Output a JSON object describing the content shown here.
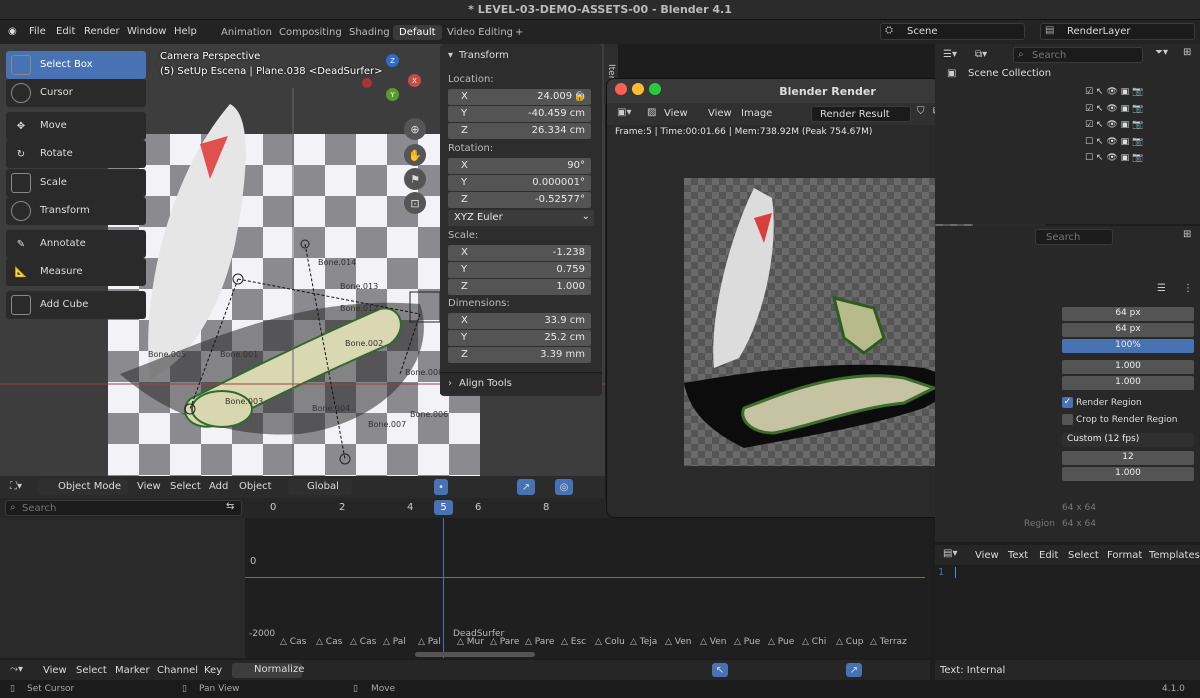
{
  "window": {
    "title": "* LEVEL-03-DEMO-ASSETS-00 - Blender 4.1"
  },
  "menu": [
    "File",
    "Edit",
    "Render",
    "Window",
    "Help"
  ],
  "workspaces": [
    "Animation",
    "Compositing",
    "Shading",
    "Default",
    "Video Editing"
  ],
  "active_workspace": "Default",
  "add_tab": "+",
  "scene": {
    "name": "Scene",
    "layer": "RenderLayer"
  },
  "tools": [
    {
      "label": "Select Box",
      "icon": "select-box-icon"
    },
    {
      "label": "Cursor",
      "icon": "cursor-icon"
    },
    {
      "label": "Move",
      "icon": "move-icon"
    },
    {
      "label": "Rotate",
      "icon": "rotate-icon"
    },
    {
      "label": "Scale",
      "icon": "scale-icon"
    },
    {
      "label": "Transform",
      "icon": "transform-icon"
    },
    {
      "label": "Annotate",
      "icon": "annotate-icon"
    },
    {
      "label": "Measure",
      "icon": "measure-icon"
    },
    {
      "label": "Add Cube",
      "icon": "add-cube-icon"
    }
  ],
  "viewport": {
    "view_name": "Camera Perspective",
    "context": "(5) SetUp Escena | Plane.038 <DeadSurfer>",
    "axis_x": "X",
    "axis_y": "Y",
    "axis_z": "Z",
    "bones": [
      "Bone.014",
      "Bone.013",
      "Bone.012",
      "Bone.005",
      "Bone.001",
      "Bone.002",
      "Bone.004",
      "Bone.003",
      "Bone.006",
      "Bone.007",
      "Bone.008"
    ],
    "mode": "Object Mode",
    "header_menus": [
      "View",
      "Select",
      "Add",
      "Object"
    ],
    "orientation": "Global"
  },
  "transform": {
    "title": "Transform",
    "location_label": "Location:",
    "location": [
      {
        "axis": "X",
        "value": "24.009 m"
      },
      {
        "axis": "Y",
        "value": "-40.459 cm"
      },
      {
        "axis": "Z",
        "value": "26.334 cm"
      }
    ],
    "rotation_label": "Rotation:",
    "rotation": [
      {
        "axis": "X",
        "value": "90°"
      },
      {
        "axis": "Y",
        "value": "0.000001°"
      },
      {
        "axis": "Z",
        "value": "-0.52577°"
      }
    ],
    "rotation_mode": "XYZ Euler",
    "scale_label": "Scale:",
    "scale": [
      {
        "axis": "X",
        "value": "-1.238"
      },
      {
        "axis": "Y",
        "value": "0.759"
      },
      {
        "axis": "Z",
        "value": "1.000"
      }
    ],
    "dimensions_label": "Dimensions:",
    "dimensions": [
      {
        "axis": "X",
        "value": "33.9 cm"
      },
      {
        "axis": "Y",
        "value": "25.2 cm"
      },
      {
        "axis": "Z",
        "value": "3.39 mm"
      }
    ],
    "align_tools": "Align Tools",
    "tab": "Item"
  },
  "render_window": {
    "title": "Blender Render",
    "menus": [
      "View",
      "View",
      "Image"
    ],
    "slot": "Render Result",
    "info": "Frame:5 | Time:00:01.66 | Mem:738.92M (Peak 754.67M)"
  },
  "outliner": {
    "search_placeholder": "Search",
    "scene_collection": "Scene Collection"
  },
  "properties": {
    "search_placeholder": "Search",
    "resolution_x": "64 px",
    "resolution_y": "64 px",
    "resolution_pct": "100%",
    "aspect_x": "1.000",
    "aspect_y": "1.000",
    "render_region": "Render Region",
    "crop_region": "Crop to Render Region",
    "frame_rate": "Custom (12 fps)",
    "fps": "12",
    "base": "1.000",
    "res_info_label": "",
    "res_info": "64 x 64",
    "region_label": "Region",
    "region_info": "64 x 64"
  },
  "text_editor": {
    "menus": [
      "View",
      "Text",
      "Edit",
      "Select",
      "Format",
      "Templates"
    ],
    "line": "1",
    "status": "Text: Internal"
  },
  "dopesheet": {
    "search_placeholder": "Search",
    "frames": [
      "0",
      "2",
      "4",
      "6",
      "8"
    ],
    "current_frame": "5",
    "value_zero": "0",
    "value_min": "-2000",
    "object": "DeadSurfer",
    "keys": [
      "Cas",
      "Cas",
      "Cas",
      "Pal",
      "Pal",
      "Mur",
      "Pare",
      "Pare",
      "Esc",
      "Colu",
      "Teja",
      "Ven",
      "Ven",
      "Pue",
      "Pue",
      "Chi",
      "Cup",
      "Terraz"
    ],
    "menus": [
      "View",
      "Select",
      "Marker",
      "Channel",
      "Key"
    ],
    "normalize": "Normalize"
  },
  "statusbar": {
    "left": "Set Cursor",
    "mid": "Pan View",
    "right": "Move",
    "version": "4.1.0"
  }
}
